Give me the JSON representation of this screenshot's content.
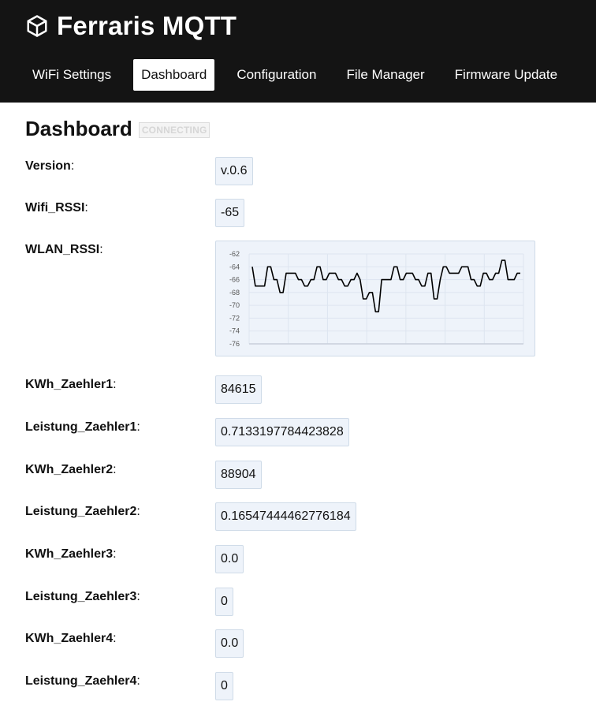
{
  "app": {
    "title": "Ferraris MQTT",
    "icon": "cube-icon"
  },
  "nav": [
    {
      "label": "WiFi Settings",
      "active": false
    },
    {
      "label": "Dashboard",
      "active": true
    },
    {
      "label": "Configuration",
      "active": false
    },
    {
      "label": "File Manager",
      "active": false
    },
    {
      "label": "Firmware Update",
      "active": false
    }
  ],
  "page": {
    "title": "Dashboard",
    "status": "CONNECTING"
  },
  "fields": {
    "version": {
      "label": "Version",
      "value": "v.0.6"
    },
    "wifi_rssi": {
      "label": "Wifi_RSSI",
      "value": "-65"
    },
    "wlan_rssi": {
      "label": "WLAN_RSSI"
    },
    "kwh1": {
      "label": "KWh_Zaehler1",
      "value": "84615"
    },
    "leistung1": {
      "label": "Leistung_Zaehler1",
      "value": "0.7133197784423828"
    },
    "kwh2": {
      "label": "KWh_Zaehler2",
      "value": "88904"
    },
    "leistung2": {
      "label": "Leistung_Zaehler2",
      "value": "0.16547444462776184"
    },
    "kwh3": {
      "label": "KWh_Zaehler3",
      "value": "0.0"
    },
    "leistung3": {
      "label": "Leistung_Zaehler3",
      "value": "0"
    },
    "kwh4": {
      "label": "KWh_Zaehler4",
      "value": "0.0"
    },
    "leistung4": {
      "label": "Leistung_Zaehler4",
      "value": "0"
    }
  },
  "chart_data": {
    "type": "line",
    "title": "",
    "xlabel": "",
    "ylabel": "",
    "ylim": [
      -76,
      -62
    ],
    "yticks": [
      "-62",
      "-64",
      "-66",
      "-68",
      "-70",
      "-72",
      "-74",
      "-76"
    ],
    "grid": true,
    "series": [
      {
        "values": [
          -64,
          -67,
          -67,
          -67,
          -67,
          -64,
          -64,
          -66,
          -66,
          -68,
          -68,
          -65,
          -65,
          -65,
          -65,
          -66,
          -66,
          -67,
          -67,
          -66,
          -66,
          -64,
          -64,
          -66,
          -66,
          -65,
          -65,
          -65,
          -66,
          -66,
          -67,
          -67,
          -66,
          -66,
          -65,
          -66,
          -69,
          -69,
          -68,
          -68,
          -71,
          -71,
          -66,
          -66,
          -66,
          -66,
          -64,
          -64,
          -66,
          -66,
          -65,
          -65,
          -65,
          -66,
          -66,
          -67,
          -67,
          -65,
          -65,
          -69,
          -69,
          -66,
          -64,
          -64,
          -65,
          -65,
          -65,
          -65,
          -64,
          -64,
          -64,
          -66,
          -66,
          -67,
          -67,
          -65,
          -65,
          -66,
          -66,
          -65,
          -65,
          -63,
          -63,
          -66,
          -66,
          -66,
          -65,
          -65
        ]
      }
    ],
    "colors": {
      "line": "#000000",
      "grid": "#dde5f0",
      "tick": "#555555"
    }
  }
}
